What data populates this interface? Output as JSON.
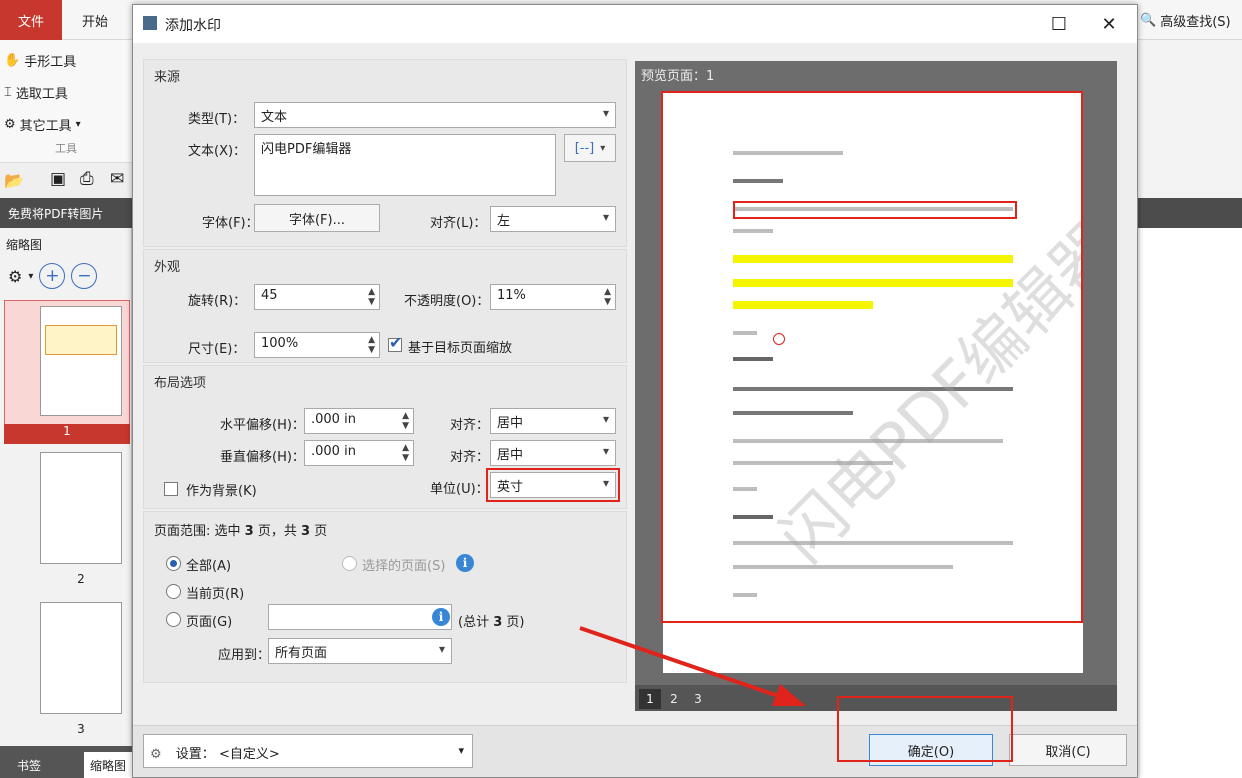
{
  "app": {
    "tabs": {
      "file": "文件",
      "start": "开始"
    },
    "tools": [
      {
        "icon": "hand-icon",
        "label": "手形工具"
      },
      {
        "icon": "select-cursor-icon",
        "label": "选取工具"
      },
      {
        "icon": "gear-icon",
        "label": "其它工具"
      }
    ],
    "tools_caption": "工具",
    "darkbar_text": "免费将PDF转图片",
    "thumbnails": {
      "header": "缩略图",
      "pages": [
        "1",
        "2",
        "3"
      ]
    },
    "bottom_tabs": {
      "bookmarks": "书签",
      "thumbs": "缩略图"
    },
    "advanced_search": "高级查找(S)"
  },
  "dialog": {
    "title": "添加水印",
    "source": {
      "title": "来源",
      "type_label": "类型(T)：",
      "type_value": "文本",
      "text_label": "文本(X)：",
      "text_value": "闪电PDF编辑器",
      "font_label": "字体(F)：",
      "font_button": "字体(F)...",
      "align_label": "对齐(L)：",
      "align_value": "左",
      "insert_button": "[--]"
    },
    "appearance": {
      "title": "外观",
      "rotate_label": "旋转(R)：",
      "rotate_value": "45",
      "opacity_label": "不透明度(O)：",
      "opacity_value": "11%",
      "size_label": "尺寸(E)：",
      "size_value": "100%",
      "scale_checkbox": "基于目标页面缩放",
      "scale_checked": true
    },
    "layout": {
      "title": "布局选项",
      "h_offset_label": "水平偏移(H)：",
      "h_offset_value": ".000 in",
      "v_offset_label": "垂直偏移(H)：",
      "v_offset_value": ".000 in",
      "h_align_label": "对齐：",
      "h_align_value": "居中",
      "v_align_label": "对齐：",
      "v_align_value": "居中",
      "unit_label": "单位(U)：",
      "unit_value": "英寸",
      "background_checkbox": "作为背景(K)",
      "background_checked": false
    },
    "page_range": {
      "title_prefix": "页面范围: 选中",
      "selected_count": "3",
      "title_mid": "页，共",
      "total_count": "3",
      "title_suffix": "页",
      "all_pages": "全部(A)",
      "selected_pages": "选择的页面(S)",
      "current_page": "当前页(R)",
      "pages": "页面(G)",
      "pages_value": "",
      "total_note_prefix": "(总计",
      "total_note_count": "3",
      "total_note_suffix": "页)",
      "apply_label": "应用到：",
      "apply_value": "所有页面"
    },
    "preview": {
      "label": "预览页面：1",
      "watermark_text": "闪电PDF编辑器",
      "pages": [
        "1",
        "2",
        "3"
      ]
    },
    "footer": {
      "settings_label": "设置：",
      "settings_value": "<自定义>",
      "ok": "确定(O)",
      "cancel": "取消(C)"
    }
  },
  "colors": {
    "accent_red": "#c8372d",
    "annotation_red": "#e0231b",
    "highlight_yellow": "#f5f500"
  }
}
